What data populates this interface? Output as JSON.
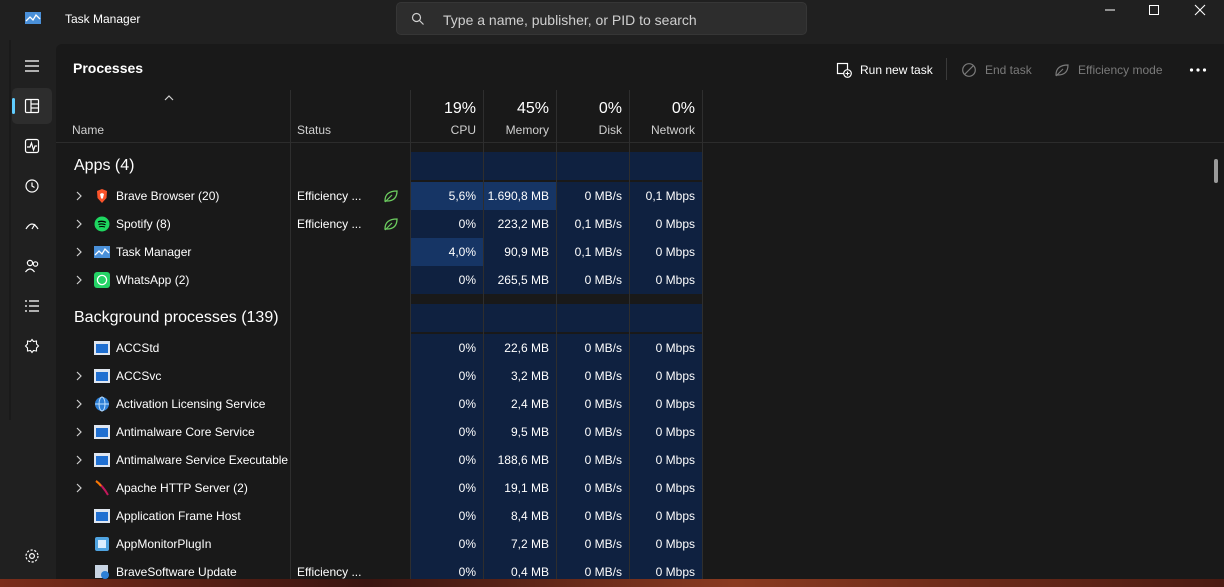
{
  "window": {
    "title": "Task Manager"
  },
  "search": {
    "placeholder": "Type a name, publisher, or PID to search"
  },
  "page": {
    "title": "Processes"
  },
  "commands": {
    "run_new_task": "Run new task",
    "end_task": "End task",
    "efficiency_mode": "Efficiency mode"
  },
  "columns": {
    "name": "Name",
    "status": "Status",
    "cpu": {
      "pct": "19%",
      "label": "CPU"
    },
    "memory": {
      "pct": "45%",
      "label": "Memory"
    },
    "disk": {
      "pct": "0%",
      "label": "Disk"
    },
    "network": {
      "pct": "0%",
      "label": "Network"
    }
  },
  "groups": {
    "apps": "Apps (4)",
    "background": "Background processes (139)"
  },
  "apps": [
    {
      "name": "Brave Browser (20)",
      "status": "Efficiency ...",
      "cpu": "5,6%",
      "memory": "1.690,8 MB",
      "disk": "0 MB/s",
      "network": "0,1 Mbps"
    },
    {
      "name": "Spotify (8)",
      "status": "Efficiency ...",
      "cpu": "0%",
      "memory": "223,2 MB",
      "disk": "0,1 MB/s",
      "network": "0 Mbps"
    },
    {
      "name": "Task Manager",
      "status": "",
      "cpu": "4,0%",
      "memory": "90,9 MB",
      "disk": "0,1 MB/s",
      "network": "0 Mbps"
    },
    {
      "name": "WhatsApp (2)",
      "status": "",
      "cpu": "0%",
      "memory": "265,5 MB",
      "disk": "0 MB/s",
      "network": "0 Mbps"
    }
  ],
  "background": [
    {
      "name": "ACCStd",
      "status": "",
      "cpu": "0%",
      "memory": "22,6 MB",
      "disk": "0 MB/s",
      "network": "0 Mbps"
    },
    {
      "name": "ACCSvc",
      "status": "",
      "cpu": "0%",
      "memory": "3,2 MB",
      "disk": "0 MB/s",
      "network": "0 Mbps"
    },
    {
      "name": "Activation Licensing Service",
      "status": "",
      "cpu": "0%",
      "memory": "2,4 MB",
      "disk": "0 MB/s",
      "network": "0 Mbps"
    },
    {
      "name": "Antimalware Core Service",
      "status": "",
      "cpu": "0%",
      "memory": "9,5 MB",
      "disk": "0 MB/s",
      "network": "0 Mbps"
    },
    {
      "name": "Antimalware Service Executable",
      "status": "",
      "cpu": "0%",
      "memory": "188,6 MB",
      "disk": "0 MB/s",
      "network": "0 Mbps"
    },
    {
      "name": "Apache HTTP Server (2)",
      "status": "",
      "cpu": "0%",
      "memory": "19,1 MB",
      "disk": "0 MB/s",
      "network": "0 Mbps"
    },
    {
      "name": "Application Frame Host",
      "status": "",
      "cpu": "0%",
      "memory": "8,4 MB",
      "disk": "0 MB/s",
      "network": "0 Mbps"
    },
    {
      "name": "AppMonitorPlugIn",
      "status": "",
      "cpu": "0%",
      "memory": "7,2 MB",
      "disk": "0 MB/s",
      "network": "0 Mbps"
    },
    {
      "name": "BraveSoftware Update",
      "status": "Efficiency ...",
      "cpu": "0%",
      "memory": "0,4 MB",
      "disk": "0 MB/s",
      "network": "0 Mbps"
    }
  ],
  "colors": {
    "accent": "#60cdff",
    "cpu_highlight": "#163565",
    "cell_tint": "#0f2140",
    "efficiency_leaf": "#6ccb5f"
  },
  "icons": {
    "sidebar": [
      "hamburger-icon",
      "processes-icon",
      "performance-icon",
      "app-history-icon",
      "startup-apps-icon",
      "users-icon",
      "details-icon",
      "services-icon",
      "settings-icon"
    ]
  }
}
